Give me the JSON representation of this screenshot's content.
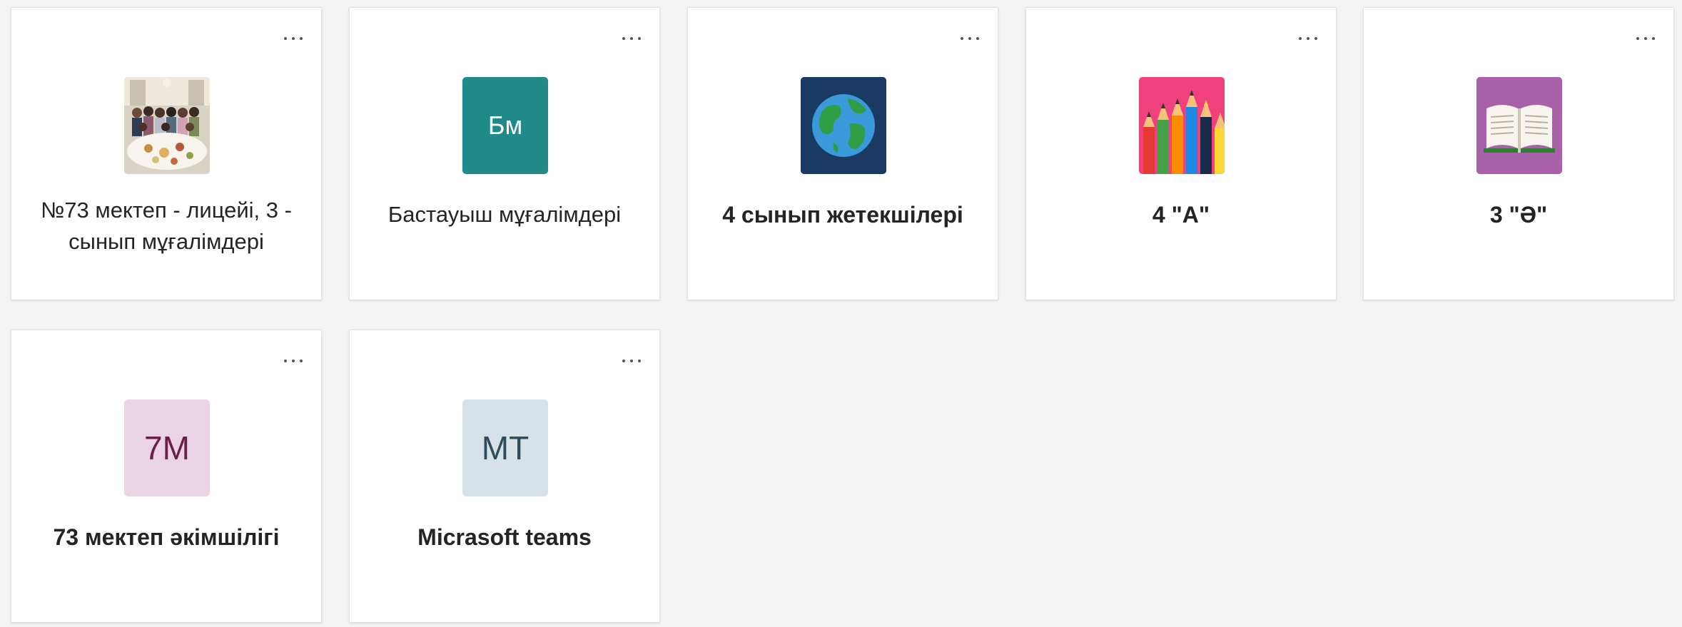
{
  "teams": [
    {
      "name": "№73 мектеп - лицейі, 3 - сынып мұғалімдері",
      "bold": false,
      "icon": "group-photo-icon",
      "more_label": "More options"
    },
    {
      "name": "Бастауыш мұғалімдері",
      "bold": false,
      "icon": "initials-icon",
      "initials": "Бм",
      "icon_bg": "#1f8a88",
      "icon_fg": "#ffffff"
    },
    {
      "name": "4 сынып жетекшілері",
      "bold": true,
      "icon": "globe-icon",
      "icon_bg": "#1b3a63"
    },
    {
      "name": "4 \"А\"",
      "bold": true,
      "icon": "pencils-icon",
      "icon_bg": "#f0407e"
    },
    {
      "name": "3 \"Ә\"",
      "bold": true,
      "icon": "book-icon",
      "icon_bg": "#a861a8"
    },
    {
      "name": "73 мектеп әкімшілігі",
      "bold": true,
      "icon": "initials-icon",
      "initials": "7М",
      "icon_bg": "#ead4e4",
      "icon_fg": "#6b2147"
    },
    {
      "name": "Micrasoft teams",
      "bold": true,
      "icon": "initials-icon",
      "initials": "МТ",
      "icon_bg": "#d6e2e8",
      "icon_fg": "#2e4c59"
    }
  ],
  "colors": {
    "background": "#f3f3f3",
    "card": "#ffffff",
    "text": "#252423"
  }
}
